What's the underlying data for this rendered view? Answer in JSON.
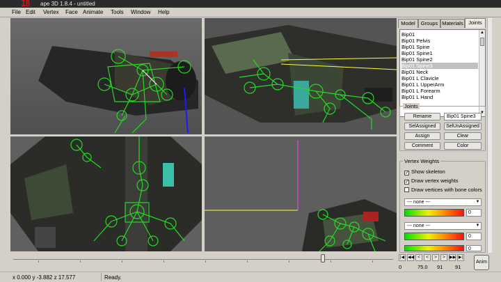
{
  "titlebar": {
    "overlay_text": "18",
    "title": "ape 3D 1.8.4 - untitled"
  },
  "menu": [
    "File",
    "Edit",
    "Vertex",
    "Face",
    "Animate",
    "Tools",
    "Window",
    "Help"
  ],
  "tabs": [
    "Model",
    "Groups",
    "Materials",
    "Joints"
  ],
  "active_tab": "Joints",
  "joint_list": [
    "Bip01",
    "Bip01 Pelvis",
    "Bip01 Spine",
    "Bip01 Spine1",
    "Bip01 Spine2",
    "Bip01 Spine3",
    "Bip01 Neck",
    "Bip01 L Clavicle",
    "Bip01 L UpperArm",
    "Bip01 L Forearm",
    "Bip01 L Hand"
  ],
  "selected_joint": "Bip01 Spine3",
  "joints_group": {
    "legend": "Joints",
    "rename_label": "Rename",
    "name_value": "Bip01 Spine3",
    "sel_assigned_label": "SelAssigned",
    "sel_unassigned_label": "SelUnAssigned",
    "assign_label": "Assign",
    "clear_label": "Clear",
    "comment_label": "Comment",
    "color_label": "Color"
  },
  "weights_group": {
    "legend": "Vertex Weights",
    "show_skeleton": "Show skeleton",
    "draw_vertex_weights": "Draw vertex weights",
    "draw_bone_colors": "Draw vertices with bone colors",
    "combo1": "--- none ---",
    "value1": "0",
    "combo2": "--- none ---",
    "value2": "0",
    "value3": "0"
  },
  "nav": {
    "frame": "0",
    "fps": "75.0",
    "current": "91",
    "total": "91",
    "anim_label": "Anim"
  },
  "status": {
    "coords": "x 0.000 y -3.882 z 17.577",
    "message": "Ready."
  },
  "colors": {
    "skeleton": "#22dd22",
    "selected_bone": "#ffffff",
    "axis_blue": "#1a1aff",
    "axis_yellow": "#ffff40",
    "axis_magenta": "#ff40ff"
  }
}
